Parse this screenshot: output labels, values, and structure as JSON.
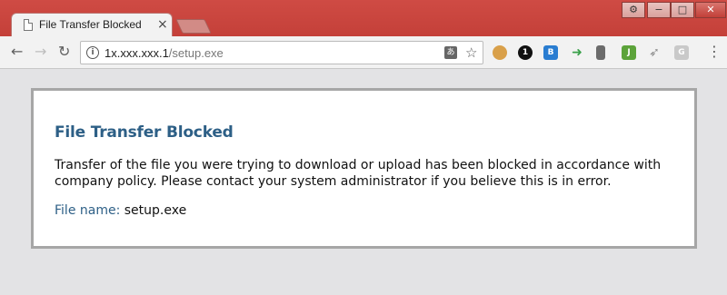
{
  "browser": {
    "tab_title": "File Transfer Blocked",
    "tab_close": "×",
    "url_host": "1̶̸.̶̶̶.̶̶̶.1",
    "url_host_plain": "1x.xxx.xxx.1",
    "url_path": "/setup.exe",
    "nav": {
      "back": "←",
      "forward": "→",
      "reload": "↻"
    },
    "window_controls": {
      "settings": "⚙",
      "minimize": "−",
      "maximize": "□",
      "close": "✕"
    },
    "extensions": [
      {
        "name": "cookie-extension-icon",
        "glyph": ""
      },
      {
        "name": "one-extension-icon",
        "glyph": "1"
      },
      {
        "name": "b-extension-icon",
        "glyph": "B"
      },
      {
        "name": "arrow-extension-icon",
        "glyph": "➜"
      },
      {
        "name": "book-extension-icon",
        "glyph": ""
      },
      {
        "name": "j-extension-icon",
        "glyph": "J"
      },
      {
        "name": "tool-extension-icon",
        "glyph": "➶"
      },
      {
        "name": "g-extension-icon",
        "glyph": "G"
      }
    ],
    "menu_glyph": "⋮",
    "star_glyph": "☆",
    "translate_glyph": "あ"
  },
  "page": {
    "heading": "File Transfer Blocked",
    "message": "Transfer of the file you were trying to download or upload has been blocked in accordance with company policy. Please contact your system administrator if you believe this is in error.",
    "file_label": "File name:",
    "file_name": "setup.exe"
  },
  "colors": {
    "heading": "#2d5f86",
    "titlebar": "#c44039"
  }
}
